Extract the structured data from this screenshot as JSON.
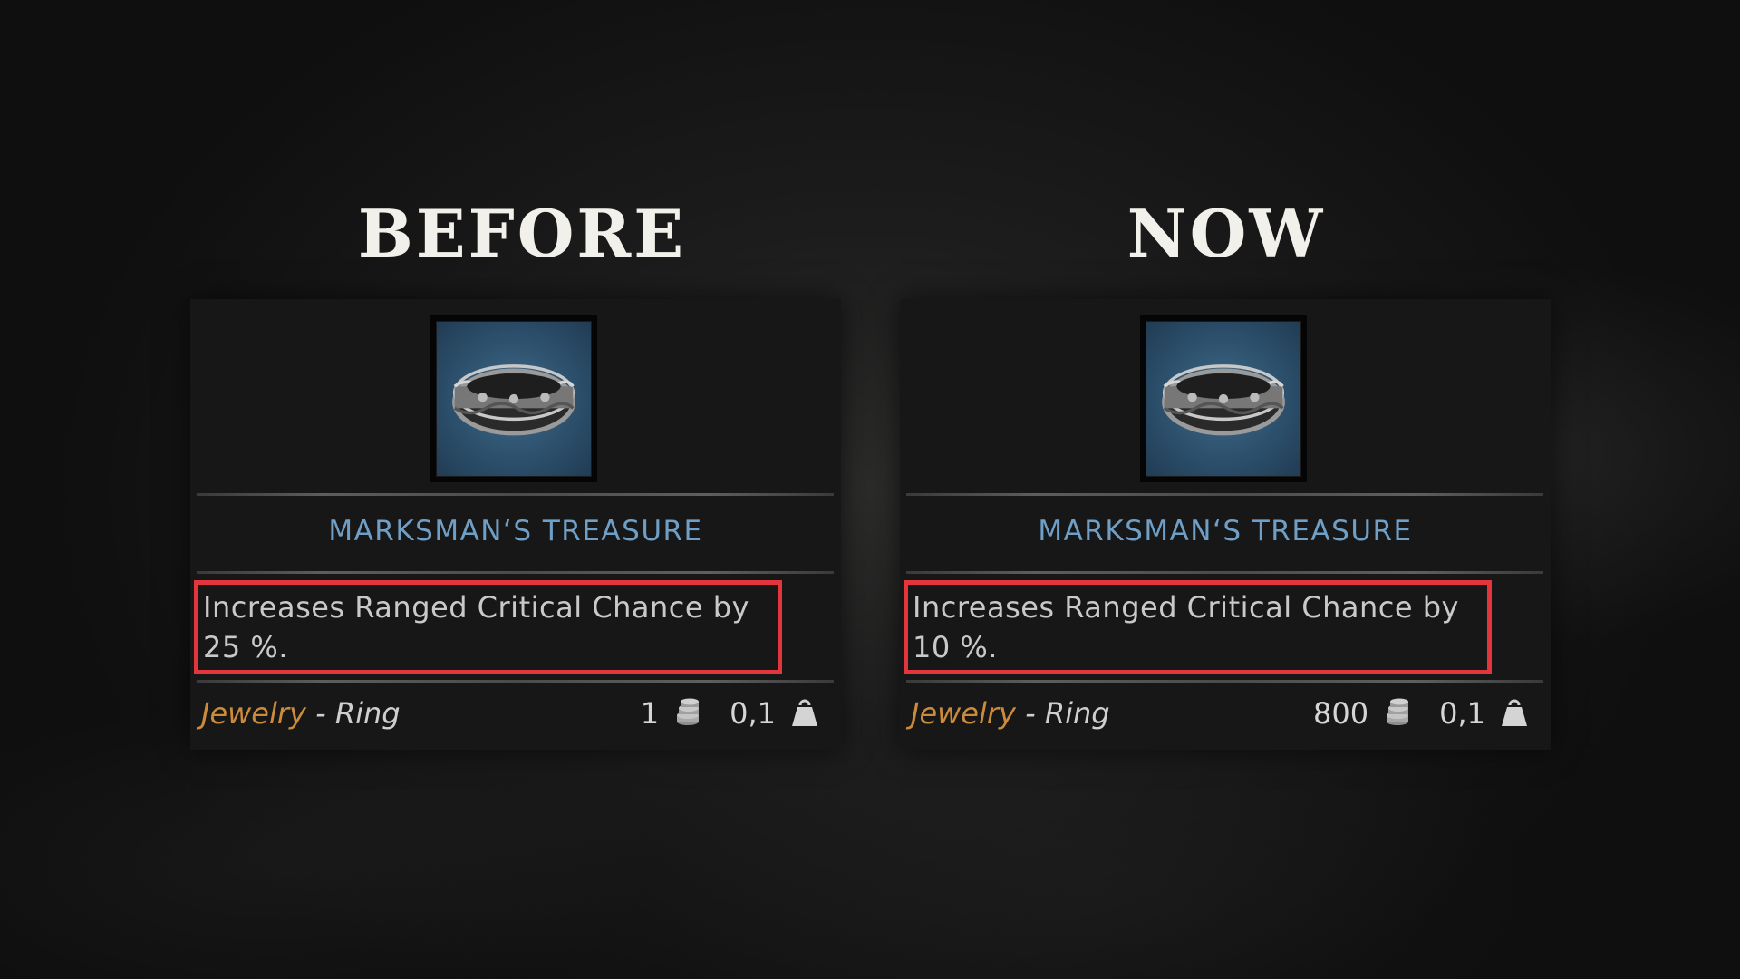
{
  "comparison": {
    "before_heading": "BEFORE",
    "now_heading": "NOW"
  },
  "cards": {
    "before": {
      "item_name": "MARKSMAN‘S TREASURE",
      "desc_line1": "Increases Ranged Critical Chance by",
      "desc_line2": "25 %.",
      "category": "Jewelry",
      "separator": " - ",
      "subtype": "Ring",
      "price": "1",
      "weight": "0,1"
    },
    "now": {
      "item_name": "MARKSMAN‘S TREASURE",
      "desc_line1": "Increases Ranged Critical Chance by",
      "desc_line2": "10 %.",
      "category": "Jewelry",
      "separator": " - ",
      "subtype": "Ring",
      "price": "800",
      "weight": "0,1"
    }
  },
  "icons": {
    "item": "ring-icon",
    "price": "coins-icon",
    "weight": "weight-icon"
  },
  "colors": {
    "item_name": "#6f9fc6",
    "category": "#cc8a3b",
    "highlight_border": "#e4353d",
    "card_background": "#171717"
  }
}
